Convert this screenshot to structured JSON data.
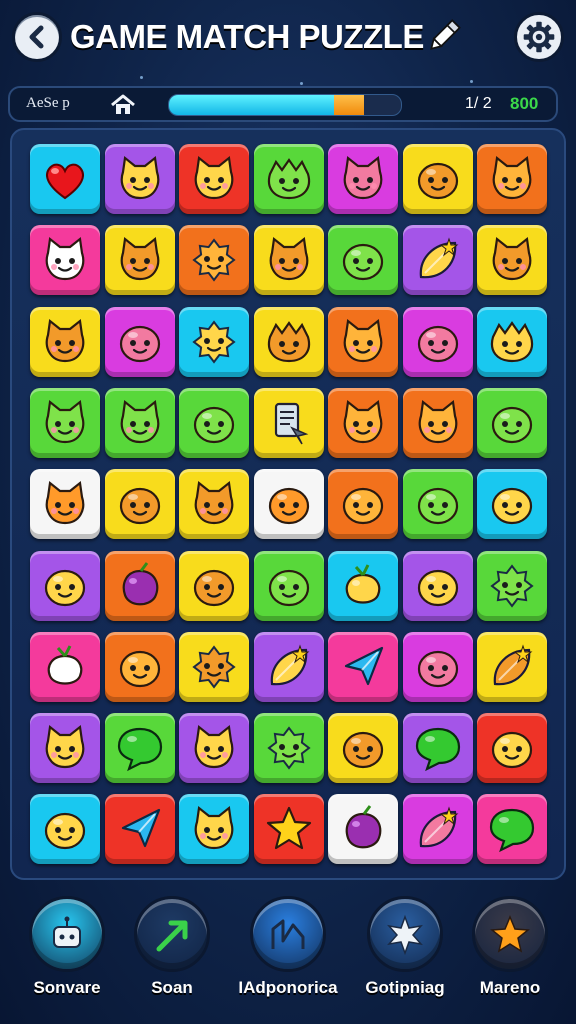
{
  "header": {
    "title": "GAME MATCH PUZZLE",
    "back_icon": "back-arrow-icon",
    "edit_icon": "pencil-icon",
    "settings_icon": "gear-icon"
  },
  "status": {
    "label": "AeSe p",
    "home_icon": "home-icon",
    "progress": 0.84,
    "level": "1/ 2",
    "score": "800"
  },
  "board": {
    "rows": 9,
    "cols": 7,
    "tiles": [
      [
        "cyan:heart",
        "purple:cat",
        "red:cat",
        "green:monster",
        "magenta:cat",
        "yellow:blob",
        "orange:cat"
      ],
      [
        "pink:cat",
        "yellow:cat",
        "orange:fuzzy",
        "yellow:cat",
        "green:blob",
        "purple:leaf",
        "yellow:cat"
      ],
      [
        "yellow:cat",
        "magenta:blob",
        "cyan:fuzzy",
        "yellow:monster",
        "orange:cat",
        "magenta:blob",
        "cyan:monster"
      ],
      [
        "green:cat",
        "green:cat",
        "green:blob",
        "yellow:scroll",
        "orange:cat",
        "orange:cat",
        "green:blob"
      ],
      [
        "white:cat",
        "yellow:blob",
        "yellow:cat",
        "white:blob",
        "orange:blob",
        "green:blob",
        "cyan:blob"
      ],
      [
        "purple:blob",
        "orange:plum",
        "yellow:blob",
        "green:blob",
        "cyan:berry",
        "purple:blob",
        "green:fuzzy"
      ],
      [
        "pink:berry",
        "orange:blob",
        "yellow:fuzzy",
        "purple:leaf",
        "pink:arrow",
        "magenta:blob",
        "yellow:leaf"
      ],
      [
        "purple:cat",
        "green:bubble",
        "purple:cat",
        "green:fuzzy",
        "yellow:blob",
        "purple:bubble",
        "red:blob"
      ],
      [
        "cyan:blob",
        "red:arrow",
        "cyan:cat",
        "red:star",
        "white:plum",
        "magenta:leaf",
        "pink:bubble"
      ]
    ],
    "colors": {
      "cyan": "#19c8f0",
      "purple": "#a455e8",
      "red": "#ee3327",
      "green": "#58d83a",
      "magenta": "#d93ce0",
      "yellow": "#f8dc1c",
      "orange": "#f2711c",
      "pink": "#f43a9c",
      "white": "#f6f6f6"
    }
  },
  "powerups": [
    {
      "label": "Sonvare",
      "icon": "robot-icon",
      "color": "#28c6ef"
    },
    {
      "label": "Soan",
      "icon": "arrow-up-right-icon",
      "color": "#1e3a64"
    },
    {
      "label": "IAdponorica",
      "icon": "chart-icon",
      "color": "#2a7fe0"
    },
    {
      "label": "Gotipniag",
      "icon": "star-burst-icon",
      "color": "#2a5ea0"
    },
    {
      "label": "Mareno",
      "icon": "star-icon",
      "color": "#3a3a48"
    }
  ]
}
